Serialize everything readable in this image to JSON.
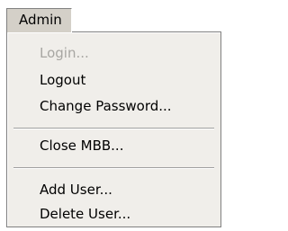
{
  "menubar": {
    "active_menu_label": "Admin"
  },
  "menu": {
    "items": [
      {
        "label": "Login...",
        "enabled": false
      },
      {
        "label": "Logout",
        "enabled": true
      },
      {
        "label": "Change Password...",
        "enabled": true
      },
      {
        "label": "Close MBB...",
        "enabled": true
      },
      {
        "label": "Add User...",
        "enabled": true
      },
      {
        "label": "Delete User...",
        "enabled": true
      }
    ]
  },
  "colors": {
    "menu_background": "#f0eeea",
    "menubar_background": "#d4d0c8",
    "disabled_text": "#a7a6a2",
    "border": "#808080"
  }
}
